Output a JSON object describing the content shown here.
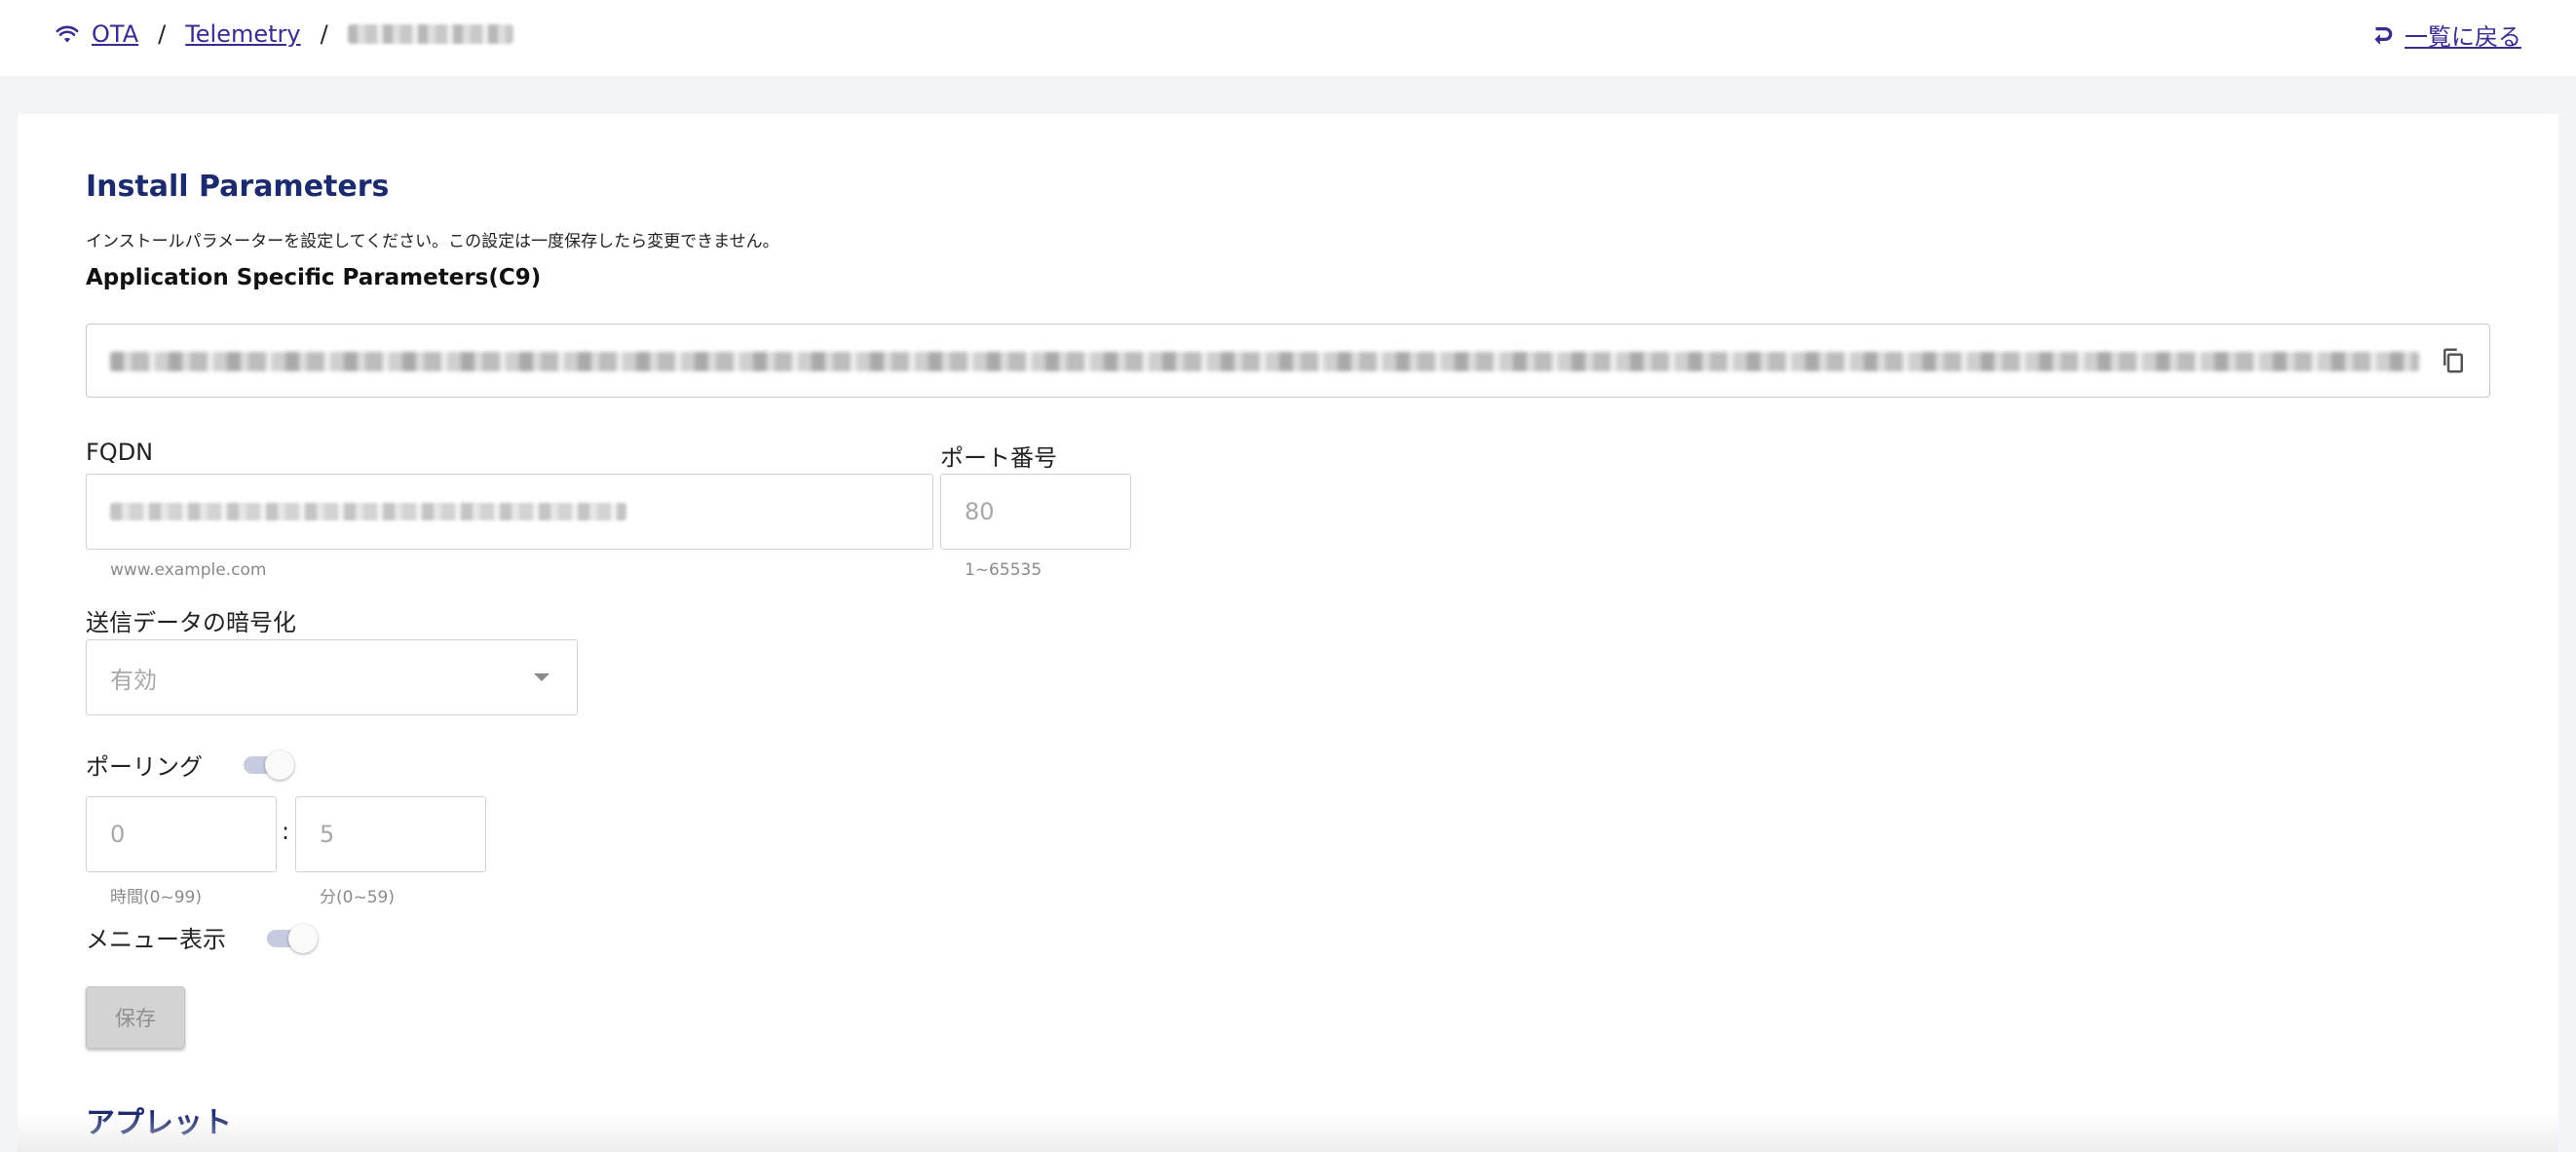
{
  "breadcrumb": {
    "items": [
      "OTA",
      "Telemetry"
    ],
    "separator": "/"
  },
  "header": {
    "back_label": "一覧に戻る"
  },
  "install": {
    "title": "Install Parameters",
    "description": "インストールパラメーターを設定してください。この設定は一度保存したら変更できません。",
    "asp_label": "Application Specific Parameters(C9)"
  },
  "fqdn": {
    "label": "FQDN",
    "helper": "www.example.com"
  },
  "port": {
    "label": "ポート番号",
    "value": "80",
    "helper": "1~65535"
  },
  "encryption": {
    "label": "送信データの暗号化",
    "value": "有効"
  },
  "polling": {
    "label": "ポーリング",
    "enabled": true,
    "hours_value": "0",
    "hours_helper": "時間(0~99)",
    "separator": ":",
    "minutes_value": "5",
    "minutes_helper": "分(0~59)"
  },
  "menu_display": {
    "label": "メニュー表示",
    "enabled": true
  },
  "save_label": "保存",
  "applet": {
    "title": "アプレット"
  },
  "icons": {
    "wifi": "wifi-icon",
    "back": "return-arrow-icon",
    "copy": "copy-icon",
    "dropdown": "chevron-down-icon"
  },
  "colors": {
    "link": "#3b2a8f",
    "title": "#1c2a6e",
    "toggle_track": "#c7cbe0",
    "background": "#f3f4f6"
  }
}
